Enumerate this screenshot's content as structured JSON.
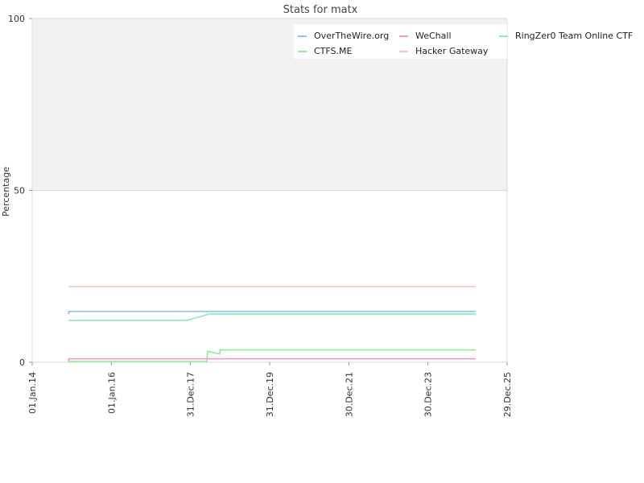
{
  "chart_data": {
    "type": "line",
    "title": "Stats for matx",
    "ylabel": "Percentage",
    "xlabel": "",
    "ylim": [
      0,
      100
    ],
    "yticks": [
      0,
      50,
      100
    ],
    "xlim": [
      "2014-01-01",
      "2025-12-29"
    ],
    "xticks": [
      {
        "date": "2014-01-01",
        "label": "01.Jan.14"
      },
      {
        "date": "2016-01-01",
        "label": "01.Jan.16"
      },
      {
        "date": "2017-12-31",
        "label": "31.Dec.17"
      },
      {
        "date": "2019-12-31",
        "label": "31.Dec.19"
      },
      {
        "date": "2021-12-30",
        "label": "30.Dec.21"
      },
      {
        "date": "2023-12-30",
        "label": "30.Dec.23"
      },
      {
        "date": "2025-12-29",
        "label": "29.Dec.25"
      }
    ],
    "band": {
      "from": 50,
      "to": 100,
      "color": "#f2f2f2"
    },
    "legend_placement": "top-right",
    "series": [
      {
        "name": "OverTheWire.org",
        "color": "#8ec3ea",
        "points": [
          [
            "2014-12-01",
            14
          ],
          [
            "2014-12-05",
            14.8
          ],
          [
            "2025-03-15",
            14.8
          ]
        ]
      },
      {
        "name": "CTFS.ME",
        "color": "#99e59e",
        "points": [
          [
            "2014-12-01",
            0.2
          ],
          [
            "2018-06-01",
            0.2
          ],
          [
            "2018-06-05",
            3.2
          ],
          [
            "2018-09-25",
            2.4
          ],
          [
            "2018-10-01",
            3.6
          ],
          [
            "2025-03-15",
            3.6
          ]
        ]
      },
      {
        "name": "WeChall",
        "color": "#ee9ec0",
        "points": [
          [
            "2014-12-01",
            0.3
          ],
          [
            "2014-12-05",
            1.0
          ],
          [
            "2025-03-15",
            1.0
          ]
        ]
      },
      {
        "name": "Hacker Gateway",
        "color": "#f7c4c8",
        "points": [
          [
            "2014-12-01",
            22
          ],
          [
            "2025-03-15",
            22
          ]
        ]
      },
      {
        "name": "RingZer0 Team Online CTF",
        "color": "#8ee3cc",
        "points": [
          [
            "2014-12-01",
            12.2
          ],
          [
            "2017-12-01",
            12.2
          ],
          [
            "2018-06-20",
            14
          ],
          [
            "2025-03-15",
            14
          ]
        ]
      }
    ]
  }
}
